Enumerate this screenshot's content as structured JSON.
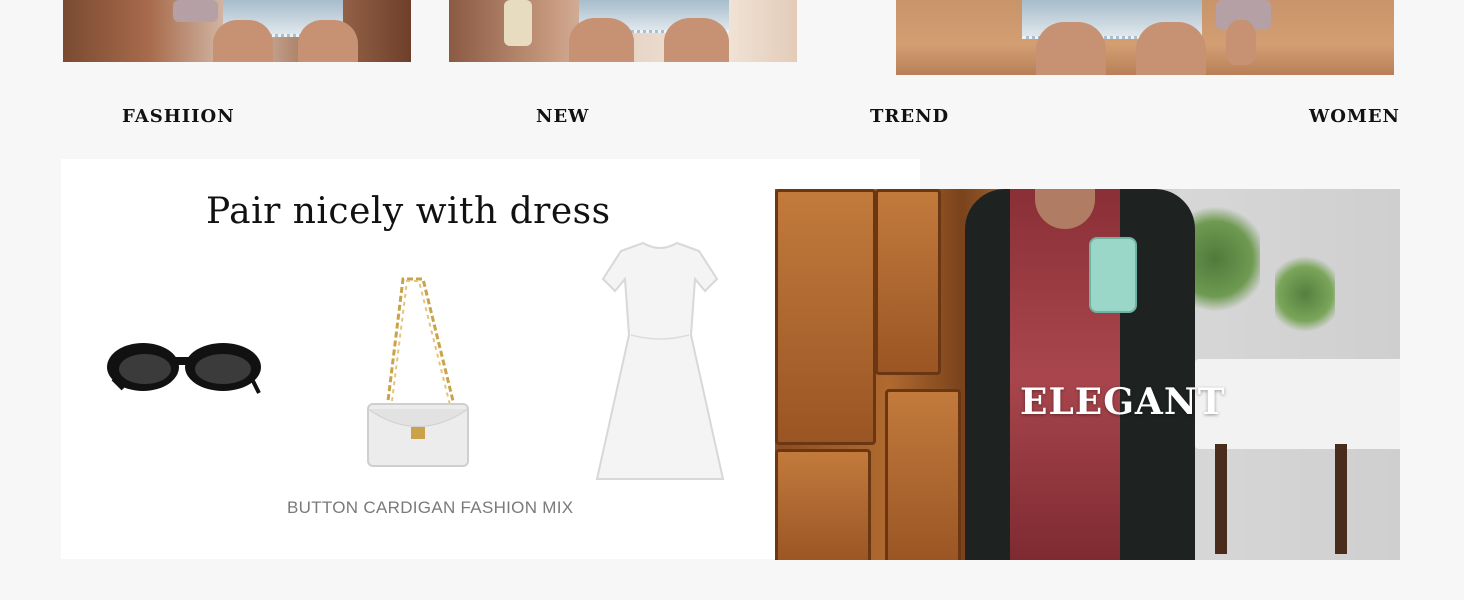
{
  "categories": [
    "FASHIION",
    "NEW",
    "TREND",
    "WOMEN"
  ],
  "pairing_panel": {
    "title": "Pair nicely with dress",
    "caption": "BUTTON CARDIGAN FASHION MIX"
  },
  "elegant_photo": {
    "label": "ELEGANT"
  },
  "colors": {
    "background": "#f7f7f7",
    "panel": "#ffffff",
    "text": "#111111",
    "caption": "#7a7a7a"
  },
  "icons": [
    "sunglasses-icon",
    "handbag-icon",
    "dress-icon"
  ]
}
